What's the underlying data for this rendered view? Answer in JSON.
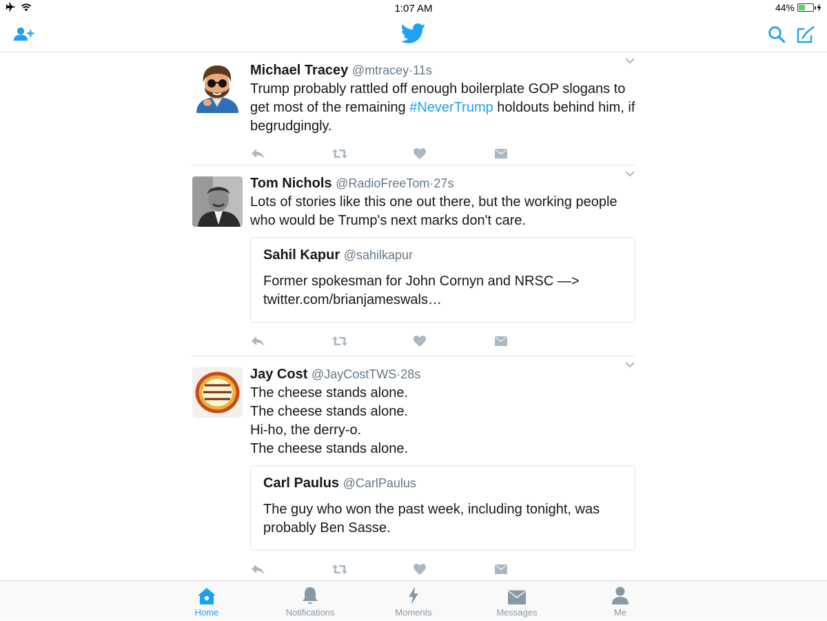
{
  "status": {
    "time": "1:07 AM",
    "battery_percent": "44%",
    "battery_level": 0.44,
    "icons": [
      "airplane-icon",
      "wifi-icon",
      "battery-icon",
      "charging-icon"
    ]
  },
  "nav": {
    "icons": [
      "add-user-icon",
      "twitter-bird-icon",
      "search-icon",
      "compose-icon"
    ]
  },
  "colors": {
    "accent": "#1da1f2",
    "text": "#14171a",
    "secondary": "#657786",
    "action_icon": "#aab8c2"
  },
  "tweets": [
    {
      "name": "Michael Tracey",
      "handle": "@mtracey",
      "sep": "·",
      "ago": "11s",
      "text_before": "Trump probably rattled off enough boilerplate GOP slogans to get most of the remaining ",
      "hashtag": "#NeverTrump",
      "text_after": " holdouts behind him, if begrudgingly."
    },
    {
      "name": "Tom Nichols",
      "handle": "@RadioFreeTom",
      "sep": "·",
      "ago": "27s",
      "text": "Lots of stories like this one out there, but the working people who would be Trump's next marks don't care.",
      "quote": {
        "name": "Sahil Kapur",
        "handle": "@sahilkapur",
        "text": "Former spokesman for John Cornyn and NRSC —> twitter.com/brianjameswals…"
      }
    },
    {
      "name": "Jay Cost",
      "handle": "@JayCostTWS",
      "sep": "·",
      "ago": "28s",
      "text": "The cheese stands alone.\nThe cheese stands alone.\nHi-ho, the derry-o.\nThe cheese stands alone.",
      "quote": {
        "name": "Carl Paulus",
        "handle": "@CarlPaulus",
        "text": "The guy who won the past week, including tonight, was probably Ben Sasse."
      }
    }
  ],
  "tabs": [
    {
      "label": "Home",
      "icon": "home-icon",
      "active": true
    },
    {
      "label": "Notifications",
      "icon": "bell-icon",
      "active": false
    },
    {
      "label": "Moments",
      "icon": "lightning-icon",
      "active": false
    },
    {
      "label": "Messages",
      "icon": "envelope-icon",
      "active": false
    },
    {
      "label": "Me",
      "icon": "person-icon",
      "active": false
    }
  ]
}
